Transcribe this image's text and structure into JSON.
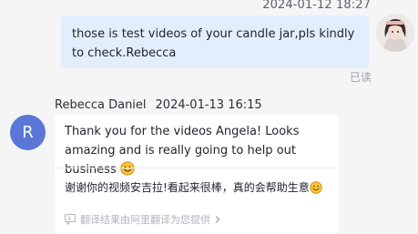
{
  "chat": {
    "outgoing": {
      "timestamp": "2024-01-12 18:27",
      "text": "those is test videos of your candle jar,pls kindly to check.Rebecca",
      "read_status": "已读"
    },
    "incoming": {
      "sender_name": "Rebecca Daniel",
      "timestamp": "2024-01-13 16:15",
      "avatar_letter": "R",
      "text": "Thank you for the videos Angela! Looks amazing and is really going to help out business",
      "translation": "谢谢你的视频安吉拉!看起来很棒，真的会帮助生意",
      "translation_note": "翻译结果由阿里翻译为您提供"
    }
  },
  "colors": {
    "outgoing_bubble": "#e3eefd",
    "avatar_accent": "#5b77d6"
  }
}
